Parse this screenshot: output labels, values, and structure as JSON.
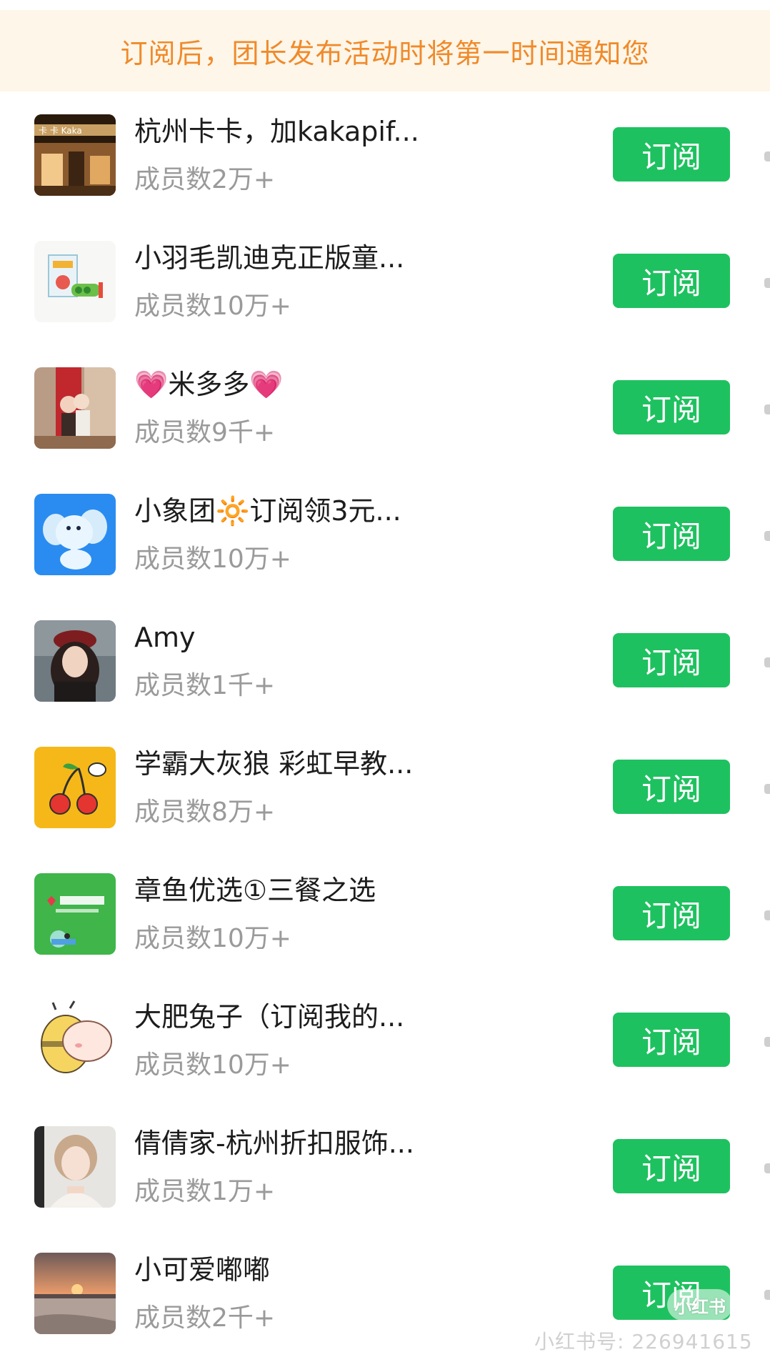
{
  "banner": {
    "text": "订阅后，团长发布活动时将第一时间通知您"
  },
  "groups": [
    {
      "name": "杭州卡卡，加kakapif...",
      "members": "成员数2万+",
      "button": "订阅",
      "avatar": "kaka-store-avatar"
    },
    {
      "name": "小羽毛凯迪克正版童...",
      "members": "成员数10万+",
      "button": "订阅",
      "avatar": "picture-books-avatar"
    },
    {
      "name": "💗米多多💗",
      "members": "成员数9千+",
      "button": "订阅",
      "avatar": "couple-photo-avatar"
    },
    {
      "name": "小象团🔆订阅领3元...",
      "members": "成员数10万+",
      "button": "订阅",
      "avatar": "elephant-avatar"
    },
    {
      "name": "Amy",
      "members": "成员数1千+",
      "button": "订阅",
      "avatar": "girl-portrait-avatar"
    },
    {
      "name": "学霸大灰狼 彩虹早教...",
      "members": "成员数8万+",
      "button": "订阅",
      "avatar": "cherry-avatar"
    },
    {
      "name": "章鱼优选①三餐之选",
      "members": "成员数10万+",
      "button": "订阅",
      "avatar": "octopus-select-avatar"
    },
    {
      "name": "大肥兔子（订阅我的...",
      "members": "成员数10万+",
      "button": "订阅",
      "avatar": "bee-cartoon-avatar"
    },
    {
      "name": "倩倩家-杭州折扣服饰...",
      "members": "成员数1万+",
      "button": "订阅",
      "avatar": "girl-selfie-avatar"
    },
    {
      "name": "小可爱嘟嘟",
      "members": "成员数2千+",
      "button": "订阅",
      "avatar": "sunset-beach-avatar"
    }
  ],
  "watermark": {
    "logo": "小红书",
    "text": "小红书号: 226941615"
  },
  "colors": {
    "banner_bg": "#fdf6e9",
    "banner_text": "#f08a2a",
    "subscribe_button": "#1ec15f",
    "member_text": "#9a9a9a"
  }
}
